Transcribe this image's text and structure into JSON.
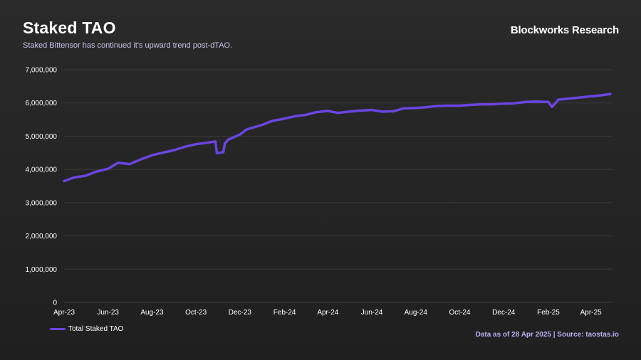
{
  "header": {
    "title": "Staked TAO",
    "subtitle": "Staked Bittensor has continued it's upward trend post-dTAO.",
    "brand": "Blockworks Research"
  },
  "footer": {
    "source": "Data as of 28 Apr 2025 | Source: taostas.io"
  },
  "colors": {
    "line": "#6a45e0",
    "grid": "#3a3a3a",
    "background": "#242424"
  },
  "chart_data": {
    "type": "line",
    "title": "Staked TAO",
    "subtitle": "Staked Bittensor has continued it's upward trend post-dTAO.",
    "xlabel": "",
    "ylabel": "",
    "ylim": [
      0,
      7000000
    ],
    "yticks": [
      0,
      1000000,
      2000000,
      3000000,
      4000000,
      5000000,
      6000000,
      7000000
    ],
    "ytick_labels": [
      "0",
      "1,000,000",
      "2,000,000",
      "3,000,000",
      "4,000,000",
      "5,000,000",
      "6,000,000",
      "7,000,000"
    ],
    "xlim": [
      "2023-04-01",
      "2025-05-01"
    ],
    "xticks": [
      "2023-04-01",
      "2023-06-01",
      "2023-08-01",
      "2023-10-01",
      "2023-12-01",
      "2024-02-01",
      "2024-04-01",
      "2024-06-01",
      "2024-08-01",
      "2024-10-01",
      "2024-12-01",
      "2025-02-01",
      "2025-04-01"
    ],
    "xtick_labels": [
      "Apr-23",
      "Jun-23",
      "Aug-23",
      "Oct-23",
      "Dec-23",
      "Feb-24",
      "Apr-24",
      "Jun-24",
      "Aug-24",
      "Oct-24",
      "Dec-24",
      "Feb-25",
      "Apr-25"
    ],
    "grid": true,
    "legend": "bottom-left",
    "series": [
      {
        "name": "Total Staked TAO",
        "color": "#6a45e0",
        "points": [
          [
            "2023-04-01",
            3650000
          ],
          [
            "2023-04-15",
            3760000
          ],
          [
            "2023-05-01",
            3810000
          ],
          [
            "2023-05-15",
            3930000
          ],
          [
            "2023-06-01",
            4020000
          ],
          [
            "2023-06-15",
            4200000
          ],
          [
            "2023-07-01",
            4160000
          ],
          [
            "2023-07-15",
            4290000
          ],
          [
            "2023-08-01",
            4430000
          ],
          [
            "2023-08-15",
            4500000
          ],
          [
            "2023-09-01",
            4580000
          ],
          [
            "2023-09-15",
            4680000
          ],
          [
            "2023-10-01",
            4760000
          ],
          [
            "2023-10-15",
            4800000
          ],
          [
            "2023-10-28",
            4840000
          ],
          [
            "2023-10-30",
            4490000
          ],
          [
            "2023-11-08",
            4520000
          ],
          [
            "2023-11-10",
            4780000
          ],
          [
            "2023-11-15",
            4900000
          ],
          [
            "2023-12-01",
            5050000
          ],
          [
            "2023-12-10",
            5200000
          ],
          [
            "2024-01-01",
            5340000
          ],
          [
            "2024-01-15",
            5460000
          ],
          [
            "2024-02-01",
            5530000
          ],
          [
            "2024-02-15",
            5600000
          ],
          [
            "2024-03-01",
            5640000
          ],
          [
            "2024-03-15",
            5720000
          ],
          [
            "2024-04-01",
            5760000
          ],
          [
            "2024-04-15",
            5700000
          ],
          [
            "2024-05-01",
            5740000
          ],
          [
            "2024-05-15",
            5770000
          ],
          [
            "2024-06-01",
            5790000
          ],
          [
            "2024-06-15",
            5740000
          ],
          [
            "2024-07-01",
            5750000
          ],
          [
            "2024-07-15",
            5840000
          ],
          [
            "2024-08-01",
            5850000
          ],
          [
            "2024-08-15",
            5870000
          ],
          [
            "2024-09-01",
            5910000
          ],
          [
            "2024-09-15",
            5920000
          ],
          [
            "2024-10-01",
            5920000
          ],
          [
            "2024-10-15",
            5940000
          ],
          [
            "2024-11-01",
            5960000
          ],
          [
            "2024-11-15",
            5960000
          ],
          [
            "2024-12-01",
            5980000
          ],
          [
            "2024-12-15",
            5990000
          ],
          [
            "2025-01-01",
            6030000
          ],
          [
            "2025-01-15",
            6040000
          ],
          [
            "2025-02-01",
            6030000
          ],
          [
            "2025-02-06",
            5880000
          ],
          [
            "2025-02-15",
            6100000
          ],
          [
            "2025-03-01",
            6130000
          ],
          [
            "2025-03-15",
            6160000
          ],
          [
            "2025-04-01",
            6200000
          ],
          [
            "2025-04-15",
            6230000
          ],
          [
            "2025-04-28",
            6270000
          ]
        ]
      }
    ]
  }
}
